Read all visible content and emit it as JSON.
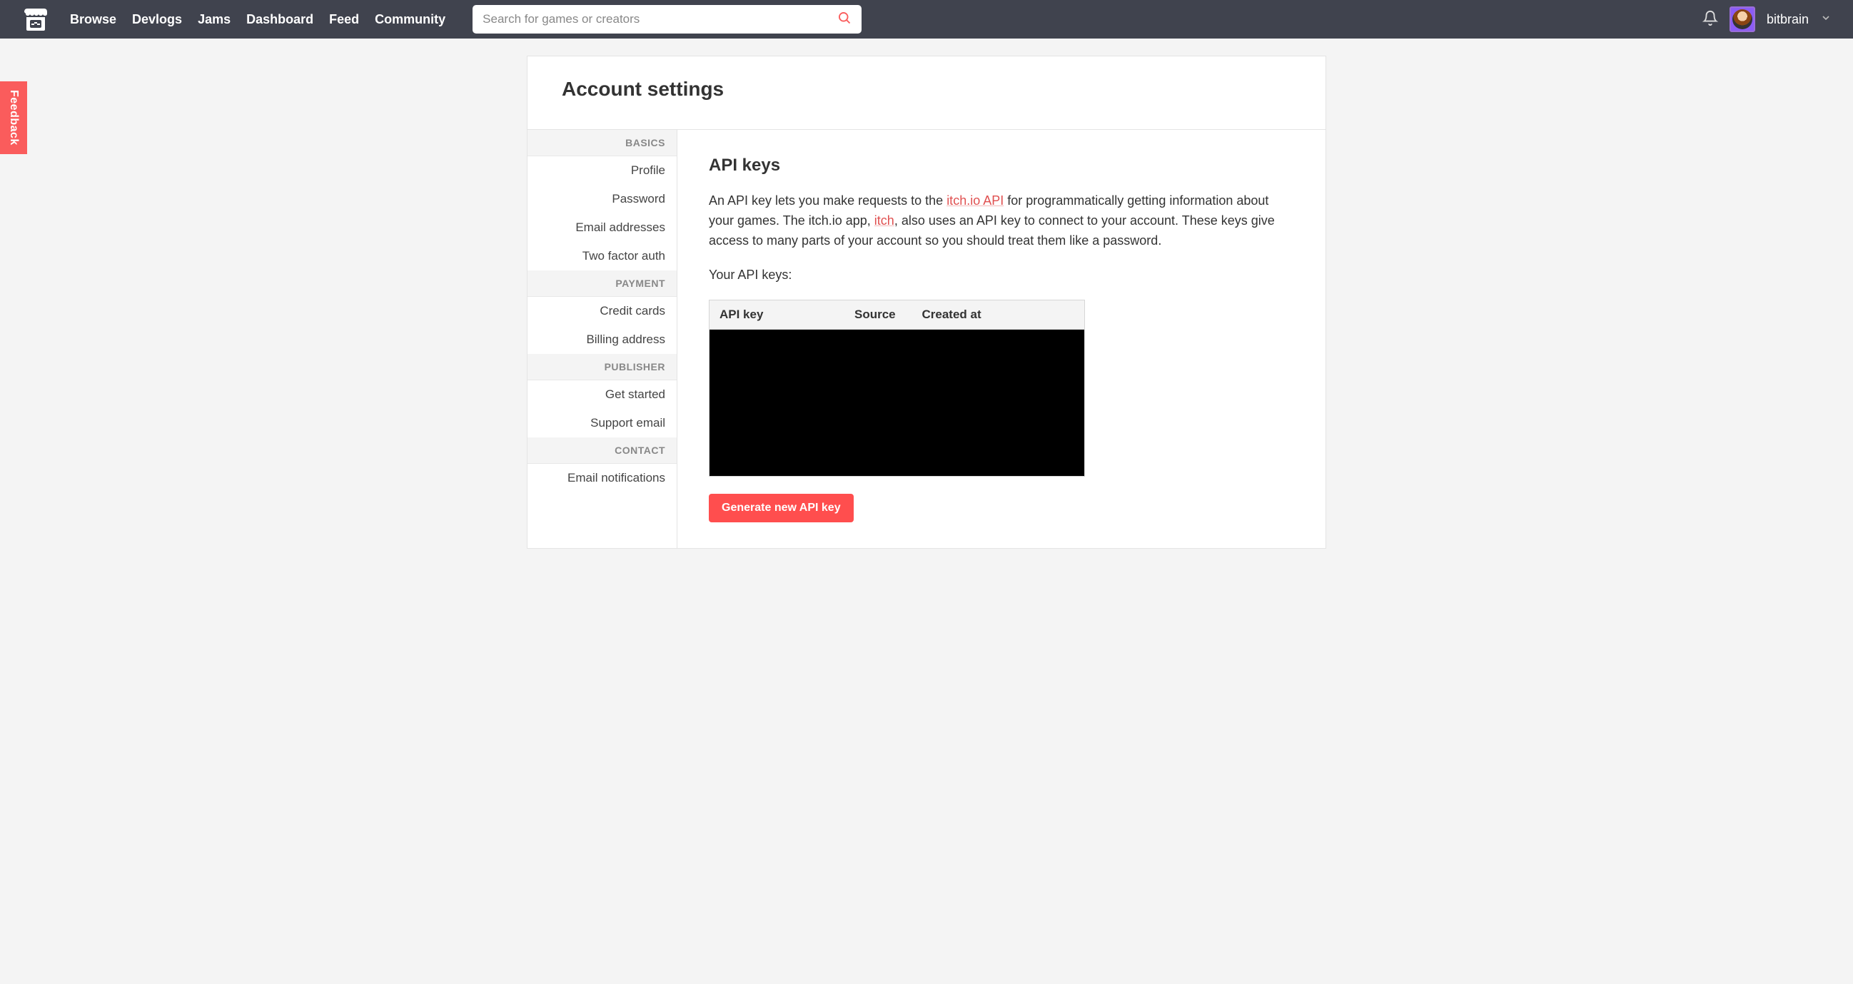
{
  "nav": {
    "links": [
      "Browse",
      "Devlogs",
      "Jams",
      "Dashboard",
      "Feed",
      "Community"
    ],
    "search_placeholder": "Search for games or creators",
    "username": "bitbrain"
  },
  "feedback_label": "Feedback",
  "page": {
    "title": "Account settings"
  },
  "sidebar": {
    "sections": [
      {
        "header": "BASICS",
        "items": [
          "Profile",
          "Password",
          "Email addresses",
          "Two factor auth"
        ]
      },
      {
        "header": "PAYMENT",
        "items": [
          "Credit cards",
          "Billing address"
        ]
      },
      {
        "header": "PUBLISHER",
        "items": [
          "Get started",
          "Support email"
        ]
      },
      {
        "header": "CONTACT",
        "items": [
          "Email notifications"
        ]
      }
    ]
  },
  "content": {
    "heading": "API keys",
    "intro": {
      "pre": "An API key lets you make requests to the ",
      "link1": "itch.io API",
      "mid1": " for programmatically getting information about your games. The itch.io app, ",
      "link2": "itch",
      "mid2": ", also uses an API key to connect to your account. These keys give access to many parts of your account so you should treat them like a password."
    },
    "your_keys_label": "Your API keys:",
    "table_headers": [
      "API key",
      "Source",
      "Created at"
    ],
    "generate_button": "Generate new API key"
  }
}
